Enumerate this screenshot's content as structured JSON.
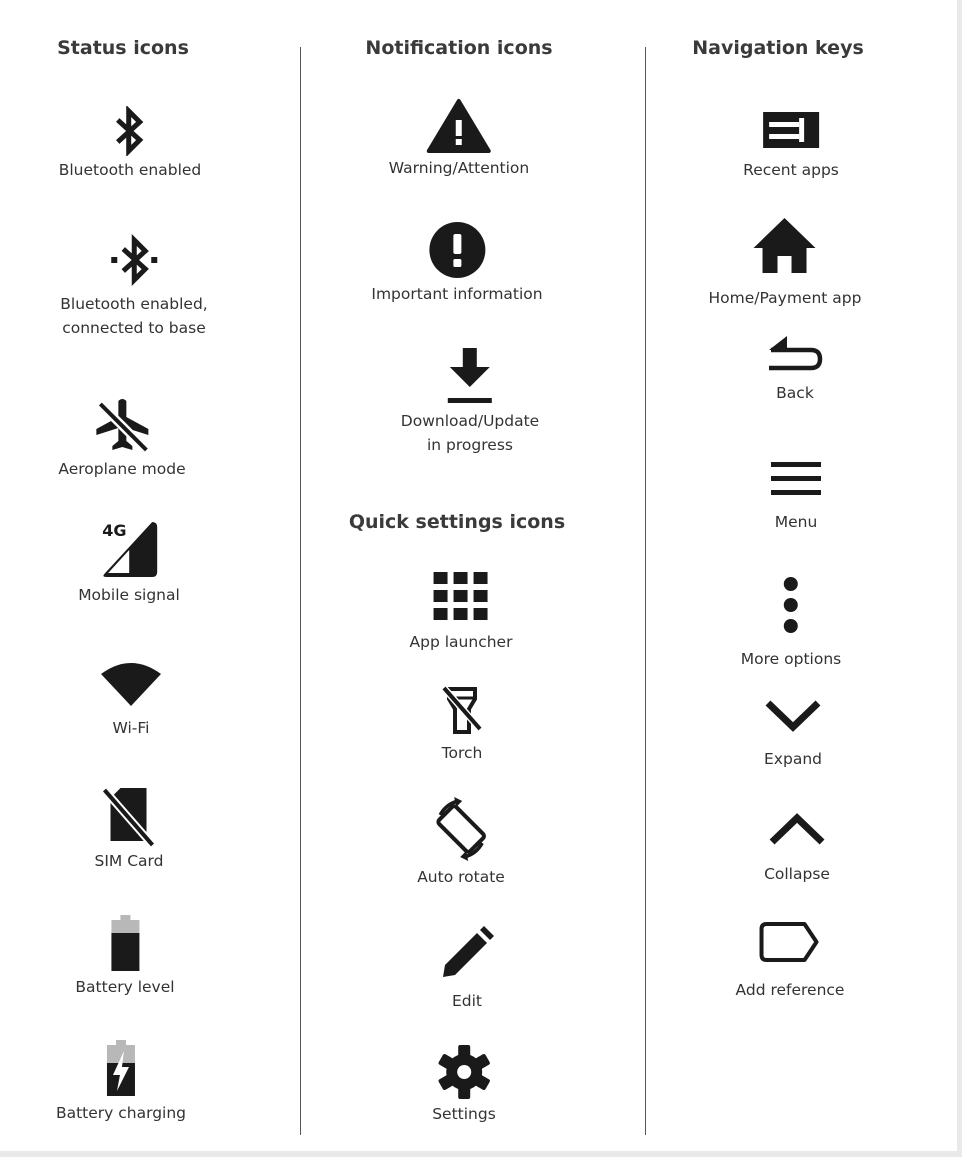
{
  "columns": {
    "status": {
      "heading": "Status icons",
      "items": [
        {
          "icon": "bluetooth-icon",
          "label": "Bluetooth enabled"
        },
        {
          "icon": "bluetooth-connected-icon",
          "label": "Bluetooth enabled,",
          "label2": "connected to base"
        },
        {
          "icon": "airplane-mode-icon",
          "label": "Aeroplane mode"
        },
        {
          "icon": "mobile-signal-4g-icon",
          "label": "Mobile signal"
        },
        {
          "icon": "wifi-icon",
          "label": "Wi-Fi"
        },
        {
          "icon": "sim-card-icon",
          "label": "SIM Card"
        },
        {
          "icon": "battery-level-icon",
          "label": "Battery level"
        },
        {
          "icon": "battery-charging-icon",
          "label": "Battery charging"
        }
      ]
    },
    "notification": {
      "heading": "Notification icons",
      "items": [
        {
          "icon": "warning-icon",
          "label": "Warning/Attention"
        },
        {
          "icon": "important-info-icon",
          "label": "Important information"
        },
        {
          "icon": "download-icon",
          "label": "Download/Update",
          "label2": "in progress"
        }
      ]
    },
    "quick_settings": {
      "heading": "Quick settings icons",
      "items": [
        {
          "icon": "app-launcher-icon",
          "label": "App launcher"
        },
        {
          "icon": "torch-icon",
          "label": "Torch"
        },
        {
          "icon": "auto-rotate-icon",
          "label": "Auto rotate"
        },
        {
          "icon": "edit-icon",
          "label": "Edit"
        },
        {
          "icon": "settings-icon",
          "label": "Settings"
        }
      ]
    },
    "navigation": {
      "heading": "Navigation keys",
      "items": [
        {
          "icon": "recent-apps-icon",
          "label": "Recent apps"
        },
        {
          "icon": "home-icon",
          "label": "Home/Payment app"
        },
        {
          "icon": "back-icon",
          "label": "Back"
        },
        {
          "icon": "menu-icon",
          "label": "Menu"
        },
        {
          "icon": "more-options-icon",
          "label": "More options"
        },
        {
          "icon": "expand-icon",
          "label": "Expand"
        },
        {
          "icon": "collapse-icon",
          "label": "Collapse"
        },
        {
          "icon": "add-reference-icon",
          "label": "Add reference"
        }
      ]
    }
  },
  "colors": {
    "icon": "#1a1a1a",
    "battery_grey": "#b8b8b8",
    "divider": "#555555"
  }
}
